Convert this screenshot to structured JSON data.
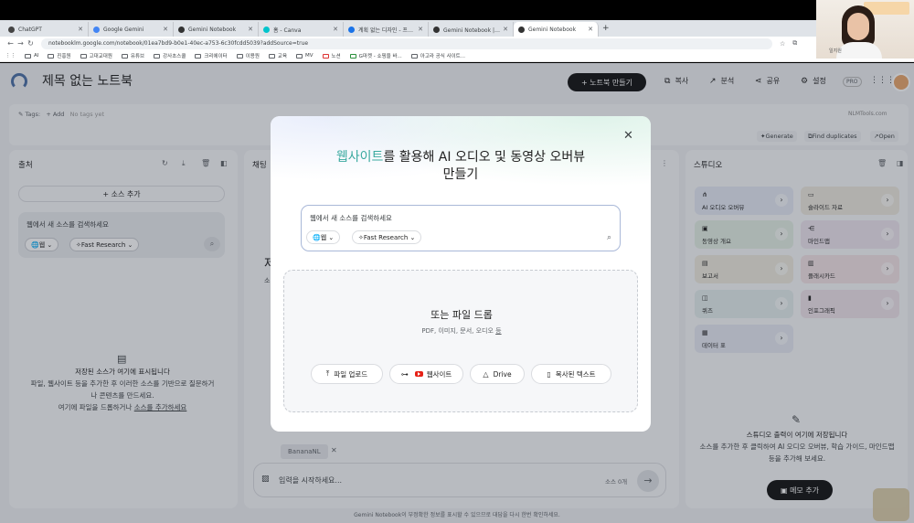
{
  "browser": {
    "tabs": [
      {
        "label": "ChatGPT",
        "color": "#444"
      },
      {
        "label": "Google Gemini",
        "color": "#4285f4"
      },
      {
        "label": "Gemini Notebook",
        "color": "#333"
      },
      {
        "label": "홈 - Canva",
        "color": "#00c4cc"
      },
      {
        "label": "계획 없는 디자인 - 프레젠테이",
        "color": "#1a73e8"
      },
      {
        "label": "Gemini Notebook | AI 조사 도",
        "color": "#333"
      },
      {
        "label": "Gemini Notebook",
        "color": "#333",
        "active": true
      }
    ],
    "url": "notebooklm.google.com/notebook/01ea7bd9-b0e1-40ec-a753-6c30fcdd5039?addSource=true",
    "bookmarks": [
      "AI",
      "진흥원",
      "고대교대원",
      "유튜브",
      "강사초스쿨",
      "크리에이터",
      "이용원",
      "교육",
      "MV",
      "노션",
      "G마켓 - 쇼핑을 바...",
      "아고라 공식 사이트..."
    ]
  },
  "webcam": {
    "name": "일지원"
  },
  "app": {
    "title": "제목 없는 노트북",
    "create_button": "+ 노트북 만들기",
    "header_actions": [
      {
        "icon": "copy-icon",
        "glyph": "⧉",
        "label": "복사"
      },
      {
        "icon": "analytics-icon",
        "glyph": "↗",
        "label": "분석"
      },
      {
        "icon": "share-icon",
        "glyph": "⋖",
        "label": "공유"
      },
      {
        "icon": "settings-icon",
        "glyph": "⚙",
        "label": "설정"
      }
    ],
    "pro_badge": "PRO",
    "tags": {
      "label": "Tags:",
      "add": "+ Add",
      "empty": "No tags yet"
    },
    "extension_brand": "NLMTools.com",
    "tag_actions": [
      "Generate",
      "Find duplicates",
      "Open"
    ]
  },
  "sources": {
    "title": "출처",
    "add_button": "+  소스 추가",
    "search_placeholder": "웹에서 새 소스를 검색하세요",
    "web_chip": "웹",
    "research_chip": "Fast Research",
    "empty_title": "저장된 소스가 여기에 표시됩니다",
    "empty_body_1": "파일, 웹사이트 등을 추가한 후 이러한 소스를 기반으로 질문하거",
    "empty_body_2": "나 콘텐츠를 만드세요.",
    "empty_body_3a": "여기에 파일을 드롭하거나 ",
    "empty_body_3b": "소스를 추가하세요"
  },
  "chat": {
    "title": "채팅",
    "peek_char_1": "제",
    "peek_char_2": "소",
    "chip_label": "BananaNL",
    "input_placeholder": "입력을 시작하세요...",
    "source_count": "소스 0개"
  },
  "studio": {
    "title": "스튜디오",
    "tiles": [
      {
        "label": "AI 오디오 오버뷰",
        "icon": "audio-icon",
        "glyph": "⋔",
        "bg": "#e4e8f4"
      },
      {
        "label": "슬라이드 자료",
        "icon": "slides-icon",
        "glyph": "▭",
        "bg": "#ece9df"
      },
      {
        "label": "동영상 개요",
        "icon": "video-icon",
        "glyph": "▣",
        "bg": "#e3eee4"
      },
      {
        "label": "마인드맵",
        "icon": "mindmap-icon",
        "glyph": "⋲",
        "bg": "#ece4ee"
      },
      {
        "label": "보고서",
        "icon": "report-icon",
        "glyph": "▤",
        "bg": "#eeeadf"
      },
      {
        "label": "플래시카드",
        "icon": "flashcard-icon",
        "glyph": "▥",
        "bg": "#f2e3e6"
      },
      {
        "label": "퀴즈",
        "icon": "quiz-icon",
        "glyph": "◫",
        "bg": "#e2ecec"
      },
      {
        "label": "인포그래픽",
        "icon": "infographic-icon",
        "glyph": "▮",
        "bg": "#eee3ea"
      },
      {
        "label": "데이터 표",
        "icon": "table-icon",
        "glyph": "▦",
        "bg": "#e5e8f2"
      }
    ],
    "empty_title": "스튜디오 출력이 여기에 저장됩니다",
    "empty_body_1": "소스를 추가한 후 클릭하여 AI 오디오 오버뷰, 학습 가이드, 마인드맵",
    "empty_body_2": "등을 추가해 보세요.",
    "note_button": "메모 추가"
  },
  "footer": "Gemini Notebook이 부정확한 정보를 표시할 수 있으므로 대답을 다시 한번 확인하세요.",
  "modal": {
    "title_highlight": "웹사이트",
    "title_rest_1": "를 활용해 AI 오디오 및 동영상 오버뷰",
    "title_rest_2": "만들기",
    "search_placeholder": "웹에서 새 소스를 검색하세요",
    "web_chip": "웹",
    "research_chip": "Fast Research",
    "drop_title": "또는 파일 드롭",
    "drop_sub_prefix": "PDF, 이미지, 문서, 오디오 ",
    "drop_sub_link": "등",
    "buttons": {
      "upload": "파일 업로드",
      "website": "웹사이트",
      "drive": "Drive",
      "paste": "복사된 텍스트"
    },
    "highlight_color": "#3aa99f"
  }
}
